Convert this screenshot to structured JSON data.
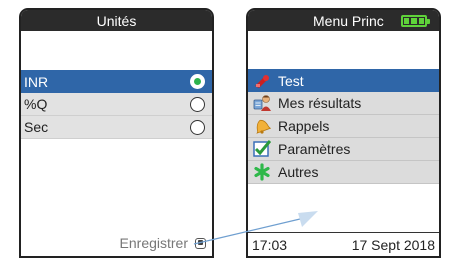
{
  "left_screen": {
    "title": "Unités",
    "options": [
      {
        "label": "INR",
        "selected": true
      },
      {
        "label": "%Q",
        "selected": false
      },
      {
        "label": "Sec",
        "selected": false
      }
    ],
    "save_label": "Enregistrer"
  },
  "right_screen": {
    "title": "Menu Princ",
    "menu": [
      {
        "label": "Test",
        "icon": "test-drop-icon",
        "active": true
      },
      {
        "label": "Mes résultats",
        "icon": "person-results-icon",
        "active": false
      },
      {
        "label": "Rappels",
        "icon": "bell-icon",
        "active": false
      },
      {
        "label": "Paramètres",
        "icon": "checkmark-icon",
        "active": false
      },
      {
        "label": "Autres",
        "icon": "asterisk-icon",
        "active": false
      }
    ],
    "status": {
      "time": "17:03",
      "date": "17 Sept 2018"
    },
    "battery_icon": "battery-full-icon"
  },
  "colors": {
    "selection_blue": "#2f66a8",
    "radio_green": "#2eb34d",
    "battery_green": "#5fd33a",
    "connector_line": "#6f9fd0"
  }
}
